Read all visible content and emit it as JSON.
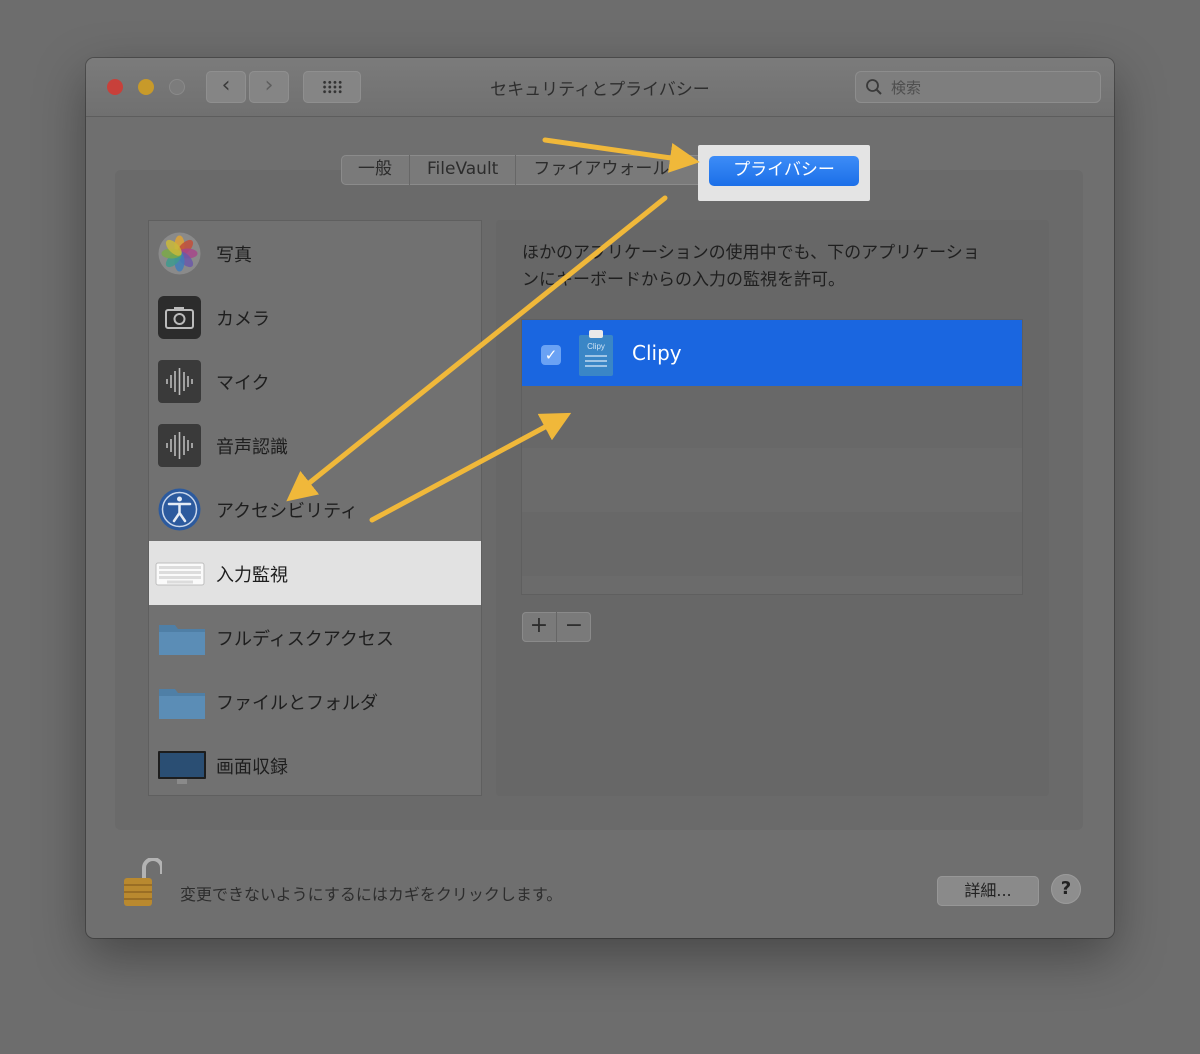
{
  "window": {
    "title": "セキュリティとプライバシー",
    "search_placeholder": "検索"
  },
  "tabs": [
    {
      "label": "一般"
    },
    {
      "label": "FileVault"
    },
    {
      "label": "ファイアウォール"
    },
    {
      "label": "プライバシー",
      "selected": true
    }
  ],
  "sidebar": {
    "items": [
      {
        "label": "写真",
        "icon": "photos-icon"
      },
      {
        "label": "カメラ",
        "icon": "camera-icon"
      },
      {
        "label": "マイク",
        "icon": "microphone-icon"
      },
      {
        "label": "音声認識",
        "icon": "speech-recognition-icon"
      },
      {
        "label": "アクセシビリティ",
        "icon": "accessibility-icon"
      },
      {
        "label": "入力監視",
        "icon": "keyboard-icon",
        "selected": true
      },
      {
        "label": "フルディスクアクセス",
        "icon": "folder-icon"
      },
      {
        "label": "ファイルとフォルダ",
        "icon": "folder-icon"
      },
      {
        "label": "画面収録",
        "icon": "display-icon"
      }
    ]
  },
  "main": {
    "description_line1": "ほかのアプリケーションの使用中でも、下のアプリケーショ",
    "description_line2": "ンにキーボードからの入力の監視を許可。",
    "apps": [
      {
        "name": "Clipy",
        "checked": true,
        "icon_text": "Clipy"
      }
    ],
    "add_label": "+",
    "remove_label": "−"
  },
  "footer": {
    "lock_text": "変更できないようにするにはカギをクリックします。",
    "details_label": "詳細...",
    "help_label": "?"
  },
  "colors": {
    "accent": "#1a66e0",
    "annotation_arrow": "#f0b83a",
    "highlight": "#e2e2e2"
  }
}
